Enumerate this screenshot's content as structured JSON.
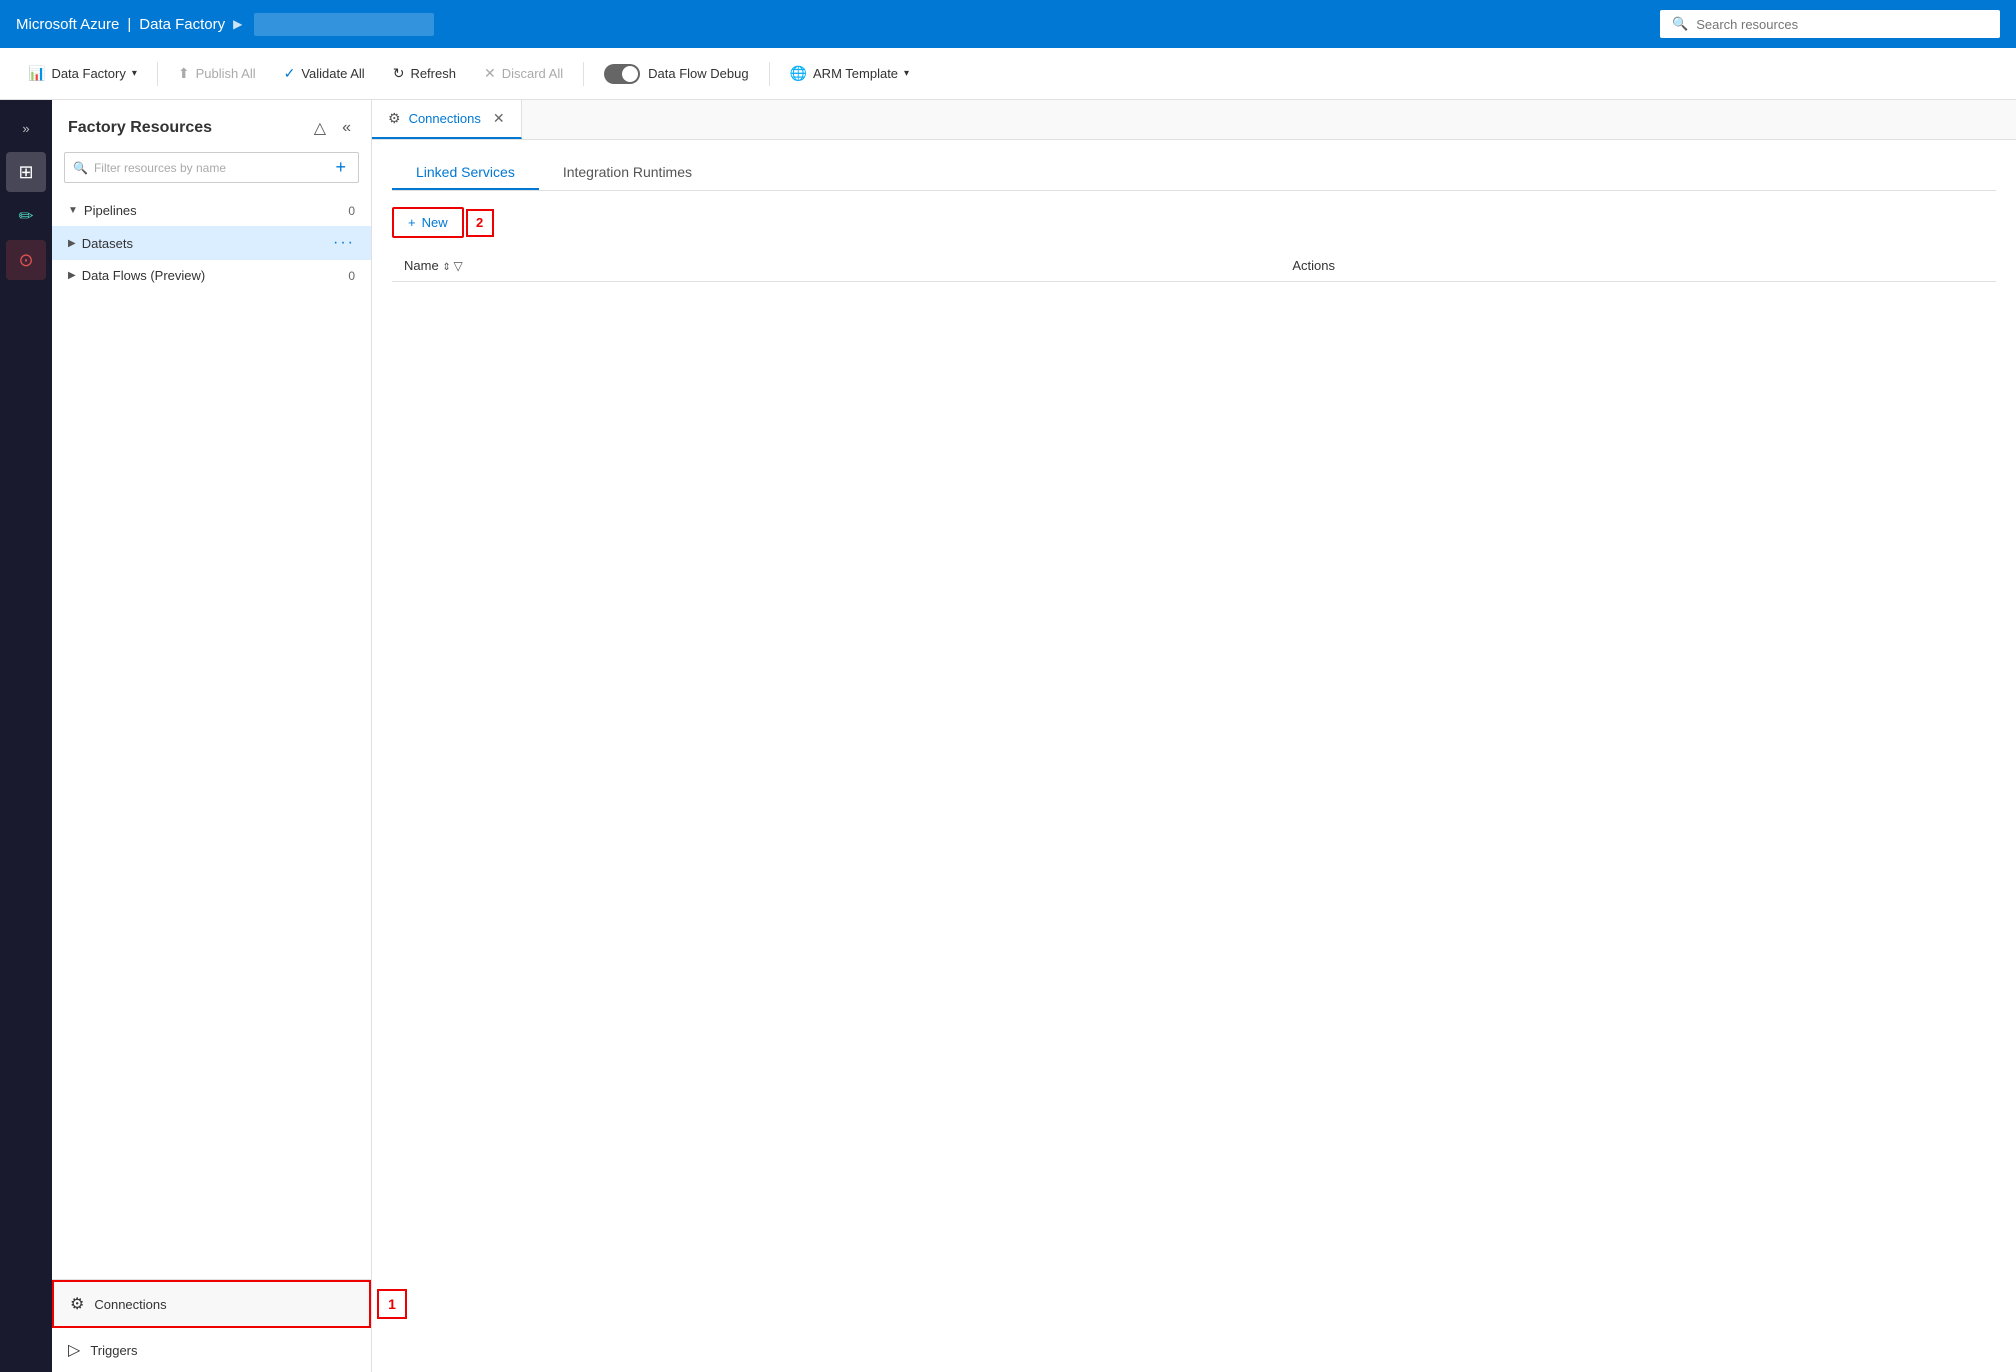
{
  "topNav": {
    "brand": "Microsoft Azure",
    "separator": "|",
    "appName": "Data Factory",
    "chevron": "▶",
    "inputPlaceholder": "",
    "searchPlaceholder": "Search resources"
  },
  "toolbar": {
    "dataFactory": "Data Factory",
    "publishAll": "Publish All",
    "validateAll": "Validate All",
    "refresh": "Refresh",
    "discardAll": "Discard All",
    "dataFlowDebug": "Data Flow Debug",
    "armTemplate": "ARM Template"
  },
  "sidebarIcons": [
    {
      "name": "expand-icon",
      "glyph": "»"
    },
    {
      "name": "grid-icon",
      "glyph": "⊞"
    },
    {
      "name": "pencil-icon",
      "glyph": "✏"
    },
    {
      "name": "circle-icon",
      "glyph": "⊙"
    }
  ],
  "resourcesPanel": {
    "title": "Factory Resources",
    "searchPlaceholder": "Filter resources by name",
    "collapseIcon": "△",
    "collapseDouble": "«",
    "addIcon": "+",
    "treeItems": [
      {
        "name": "Pipelines",
        "count": "0",
        "expanded": true,
        "indent": false
      },
      {
        "name": "Datasets",
        "dots": "···",
        "expanded": false,
        "indent": false
      },
      {
        "name": "Data Flows (Preview)",
        "count": "0",
        "expanded": false,
        "indent": false
      }
    ]
  },
  "bottomNav": [
    {
      "name": "Connections",
      "icon": "⚙",
      "annotationNum": "1"
    },
    {
      "name": "Triggers",
      "icon": "▷"
    }
  ],
  "mainTab": {
    "title": "Connections",
    "icon": "⚙",
    "closeIcon": "✕"
  },
  "subTabs": [
    {
      "name": "Linked Services",
      "active": true
    },
    {
      "name": "Integration Runtimes",
      "active": false
    }
  ],
  "actionsBar": {
    "newLabel": "New",
    "newIcon": "+",
    "annotationNum": "2"
  },
  "table": {
    "columns": [
      {
        "label": "Name",
        "sortIcon": "⇕",
        "filterIcon": "▽"
      },
      {
        "label": "Actions"
      }
    ],
    "rows": []
  }
}
